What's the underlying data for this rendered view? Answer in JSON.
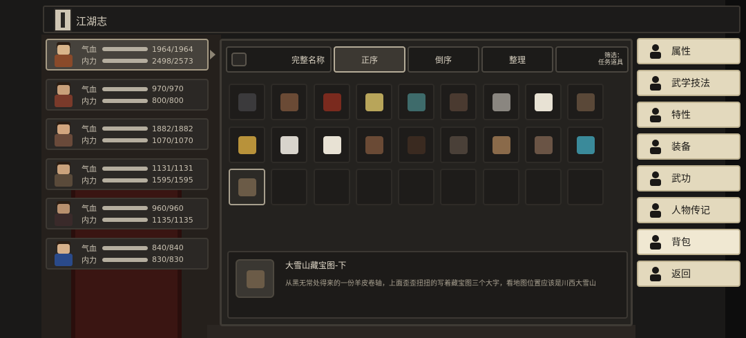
{
  "title": "江湖志",
  "party": [
    {
      "hp_label": "气血",
      "hp": "1964/1964",
      "mp_label": "内力",
      "mp": "2498/2573",
      "selected": true
    },
    {
      "hp_label": "气血",
      "hp": "970/970",
      "mp_label": "内力",
      "mp": "800/800"
    },
    {
      "hp_label": "气血",
      "hp": "1882/1882",
      "mp_label": "内力",
      "mp": "1070/1070"
    },
    {
      "hp_label": "气血",
      "hp": "1131/1131",
      "mp_label": "内力",
      "mp": "1595/1595"
    },
    {
      "hp_label": "气血",
      "hp": "960/960",
      "mp_label": "内力",
      "mp": "1135/1135"
    },
    {
      "hp_label": "气血",
      "hp": "840/840",
      "mp_label": "内力",
      "mp": "830/830"
    }
  ],
  "toolbar": {
    "full_name": "完整名称",
    "ascending": "正序",
    "descending": "倒序",
    "organize": "整理",
    "filter_line1": "筛选：",
    "filter_line2": "任务道具"
  },
  "items": [
    {
      "name": "key-dark",
      "color": "#3b3a3c"
    },
    {
      "name": "pot-brown",
      "color": "#6a4a35"
    },
    {
      "name": "red-scroll",
      "color": "#7a2a1e"
    },
    {
      "name": "yellow-paper",
      "color": "#b8a55a"
    },
    {
      "name": "teal-jar",
      "color": "#3e6b6b"
    },
    {
      "name": "dark-horn",
      "color": "#4a3a30"
    },
    {
      "name": "grey-paper",
      "color": "#8a8680"
    },
    {
      "name": "white-duck",
      "color": "#e8e2d4"
    },
    {
      "name": "brown-map",
      "color": "#5a4838"
    },
    {
      "name": "gold-key",
      "color": "#b8923a"
    },
    {
      "name": "white-feather",
      "color": "#d8d4cc"
    },
    {
      "name": "white-duck-2",
      "color": "#e8e2d4"
    },
    {
      "name": "pot-brown-2",
      "color": "#6a4a35"
    },
    {
      "name": "dark-bundle",
      "color": "#3a2a20"
    },
    {
      "name": "dark-cloth",
      "color": "#4a4038"
    },
    {
      "name": "tan-scroll",
      "color": "#8a6a4a"
    },
    {
      "name": "brown-map-2",
      "color": "#6a5445"
    },
    {
      "name": "teal-key",
      "color": "#3a8a9a"
    },
    {
      "name": "treasure-map-scroll",
      "color": "#6b5b47",
      "selected": true
    }
  ],
  "grid_slots": 27,
  "selected_item": {
    "title": "大雪山藏宝图-下",
    "description": "从黑无常处得来的一份羊皮卷轴，上面歪歪扭扭的写着藏宝图三个大字，看地图位置应该是川西大雪山"
  },
  "menu": [
    {
      "label": "属性",
      "icon": "person-icon"
    },
    {
      "label": "武学技法",
      "icon": "skill-icon"
    },
    {
      "label": "特性",
      "icon": "trait-icon"
    },
    {
      "label": "装备",
      "icon": "sword-icon"
    },
    {
      "label": "武功",
      "icon": "book-icon"
    },
    {
      "label": "人物传记",
      "icon": "biography-icon"
    },
    {
      "label": "背包",
      "icon": "bag-icon",
      "active": true
    },
    {
      "label": "返回",
      "icon": "door-icon"
    }
  ]
}
